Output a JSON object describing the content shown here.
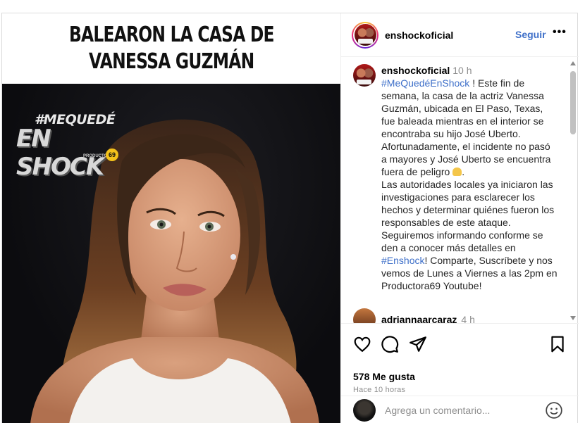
{
  "post": {
    "headline_line1": "BALEARON LA CASA DE",
    "headline_line2": "VANESSA GUZMÁN",
    "logo": {
      "line1": "#MEQUEDÉ",
      "line2": "EN SHOCK",
      "line3": "PRODUCTORA",
      "badge": "69"
    }
  },
  "header": {
    "username": "enshockoficial",
    "follow_label": "Seguir",
    "more_label": "•••"
  },
  "caption": {
    "username": "enshockoficial",
    "time": "10 h",
    "hashtag1": "#MeQuedéEnShock",
    "text1": " ! Este fin de semana, la casa de la actriz Vanessa Guzmán, ubicada en El Paso, Texas, fue baleada mientras en el interior se encontraba su hijo José Uberto. Afortunadamente, el incidente no pasó a mayores y José Uberto se encuentra fuera de peligro ",
    "text2": ".",
    "text3": "Las autoridades locales ya iniciaron las investigaciones para esclarecer los hechos y determinar quiénes fueron los responsables de este ataque.",
    "text4": "Seguiremos informando conforme se den a conocer más detalles en ",
    "hashtag2": "#Enshock",
    "text5": "! Comparte, Suscríbete y nos vemos de Lunes a Viernes a las 2pm en Productora69 Youtube!"
  },
  "comments": [
    {
      "username": "adriannaarcaraz",
      "time": "4 h"
    }
  ],
  "actions": {
    "likes": "578 Me gusta",
    "ago": "Hace 10 horas"
  },
  "add_comment": {
    "placeholder": "Agrega un comentario..."
  },
  "colors": {
    "link": "#3f70c9",
    "muted": "#8e8e8e",
    "border": "#dbdbdb"
  }
}
